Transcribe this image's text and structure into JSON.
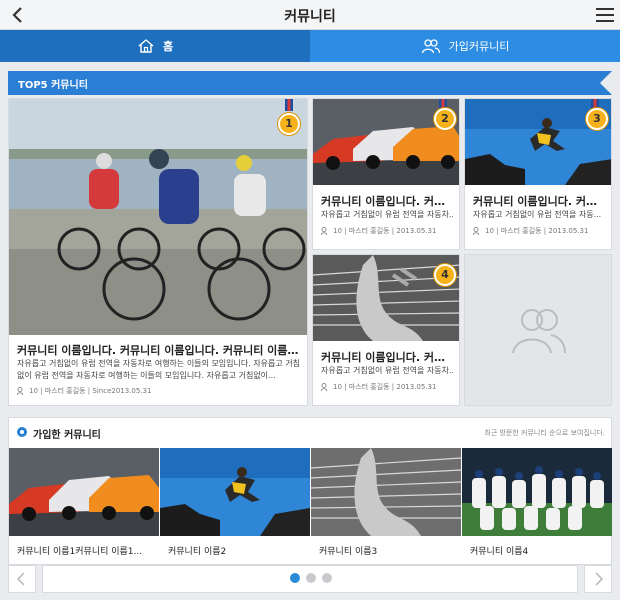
{
  "header": {
    "title": "커뮤니티"
  },
  "tabs": [
    {
      "label": "홈",
      "icon": "home-icon"
    },
    {
      "label": "가입커뮤니티",
      "icon": "users-icon"
    }
  ],
  "top5": {
    "label": "TOP5 커뮤니티",
    "featured": {
      "rank": "1",
      "title": "커뮤니티 이름입니다. 커뮤니티 이름입니다. 커뮤니티 이름입...",
      "desc": "자유롭고 거침없이 유럽 전역을 자동차로 여행하는 이들의 모임입니다. 자유롭고 거침없이 유럽 전역을 자동차로 여행하는 이들의 모임입니다. 자유롭고 거침없이...",
      "meta": "10 | 마스터 홍길동 | Since2013.05.31"
    },
    "items": [
      {
        "rank": "2",
        "title": "커뮤니티 이름입니다. 커뮤...",
        "desc": "자유롭고 거침없이 유럽 전역을 자동차...",
        "meta": "10 | 마스터 홍길동 | 2013.05.31"
      },
      {
        "rank": "3",
        "title": "커뮤니티 이름입니다. 커뮤...",
        "desc": "자유롭고 거침없이 유럽 전역을 자동...",
        "meta": "10 | 마스터 홍길동 | 2013.05.31"
      },
      {
        "rank": "4",
        "title": "커뮤니티 이름입니다. 커뮤...",
        "desc": "자유롭고 거침없이 유럽 전역을 자동차...",
        "meta": "10 | 마스터 홍길동 | 2013.05.31"
      }
    ]
  },
  "joined": {
    "heading": "가입한 커뮤니티",
    "note": "최근 방문한 커뮤니티 순으로 보여집니다.",
    "items": [
      {
        "name": "커뮤니티 이름1커뮤니티 이름1..."
      },
      {
        "name": "커뮤니티 이름2"
      },
      {
        "name": "커뮤니티 이름3"
      },
      {
        "name": "커뮤니티 이름4"
      }
    ]
  },
  "pager": {
    "pages": 3,
    "current": 1
  },
  "colors": {
    "accent": "#2a7ed4",
    "tab_active": "#1f6fbf",
    "badge": "#f6b21a"
  }
}
